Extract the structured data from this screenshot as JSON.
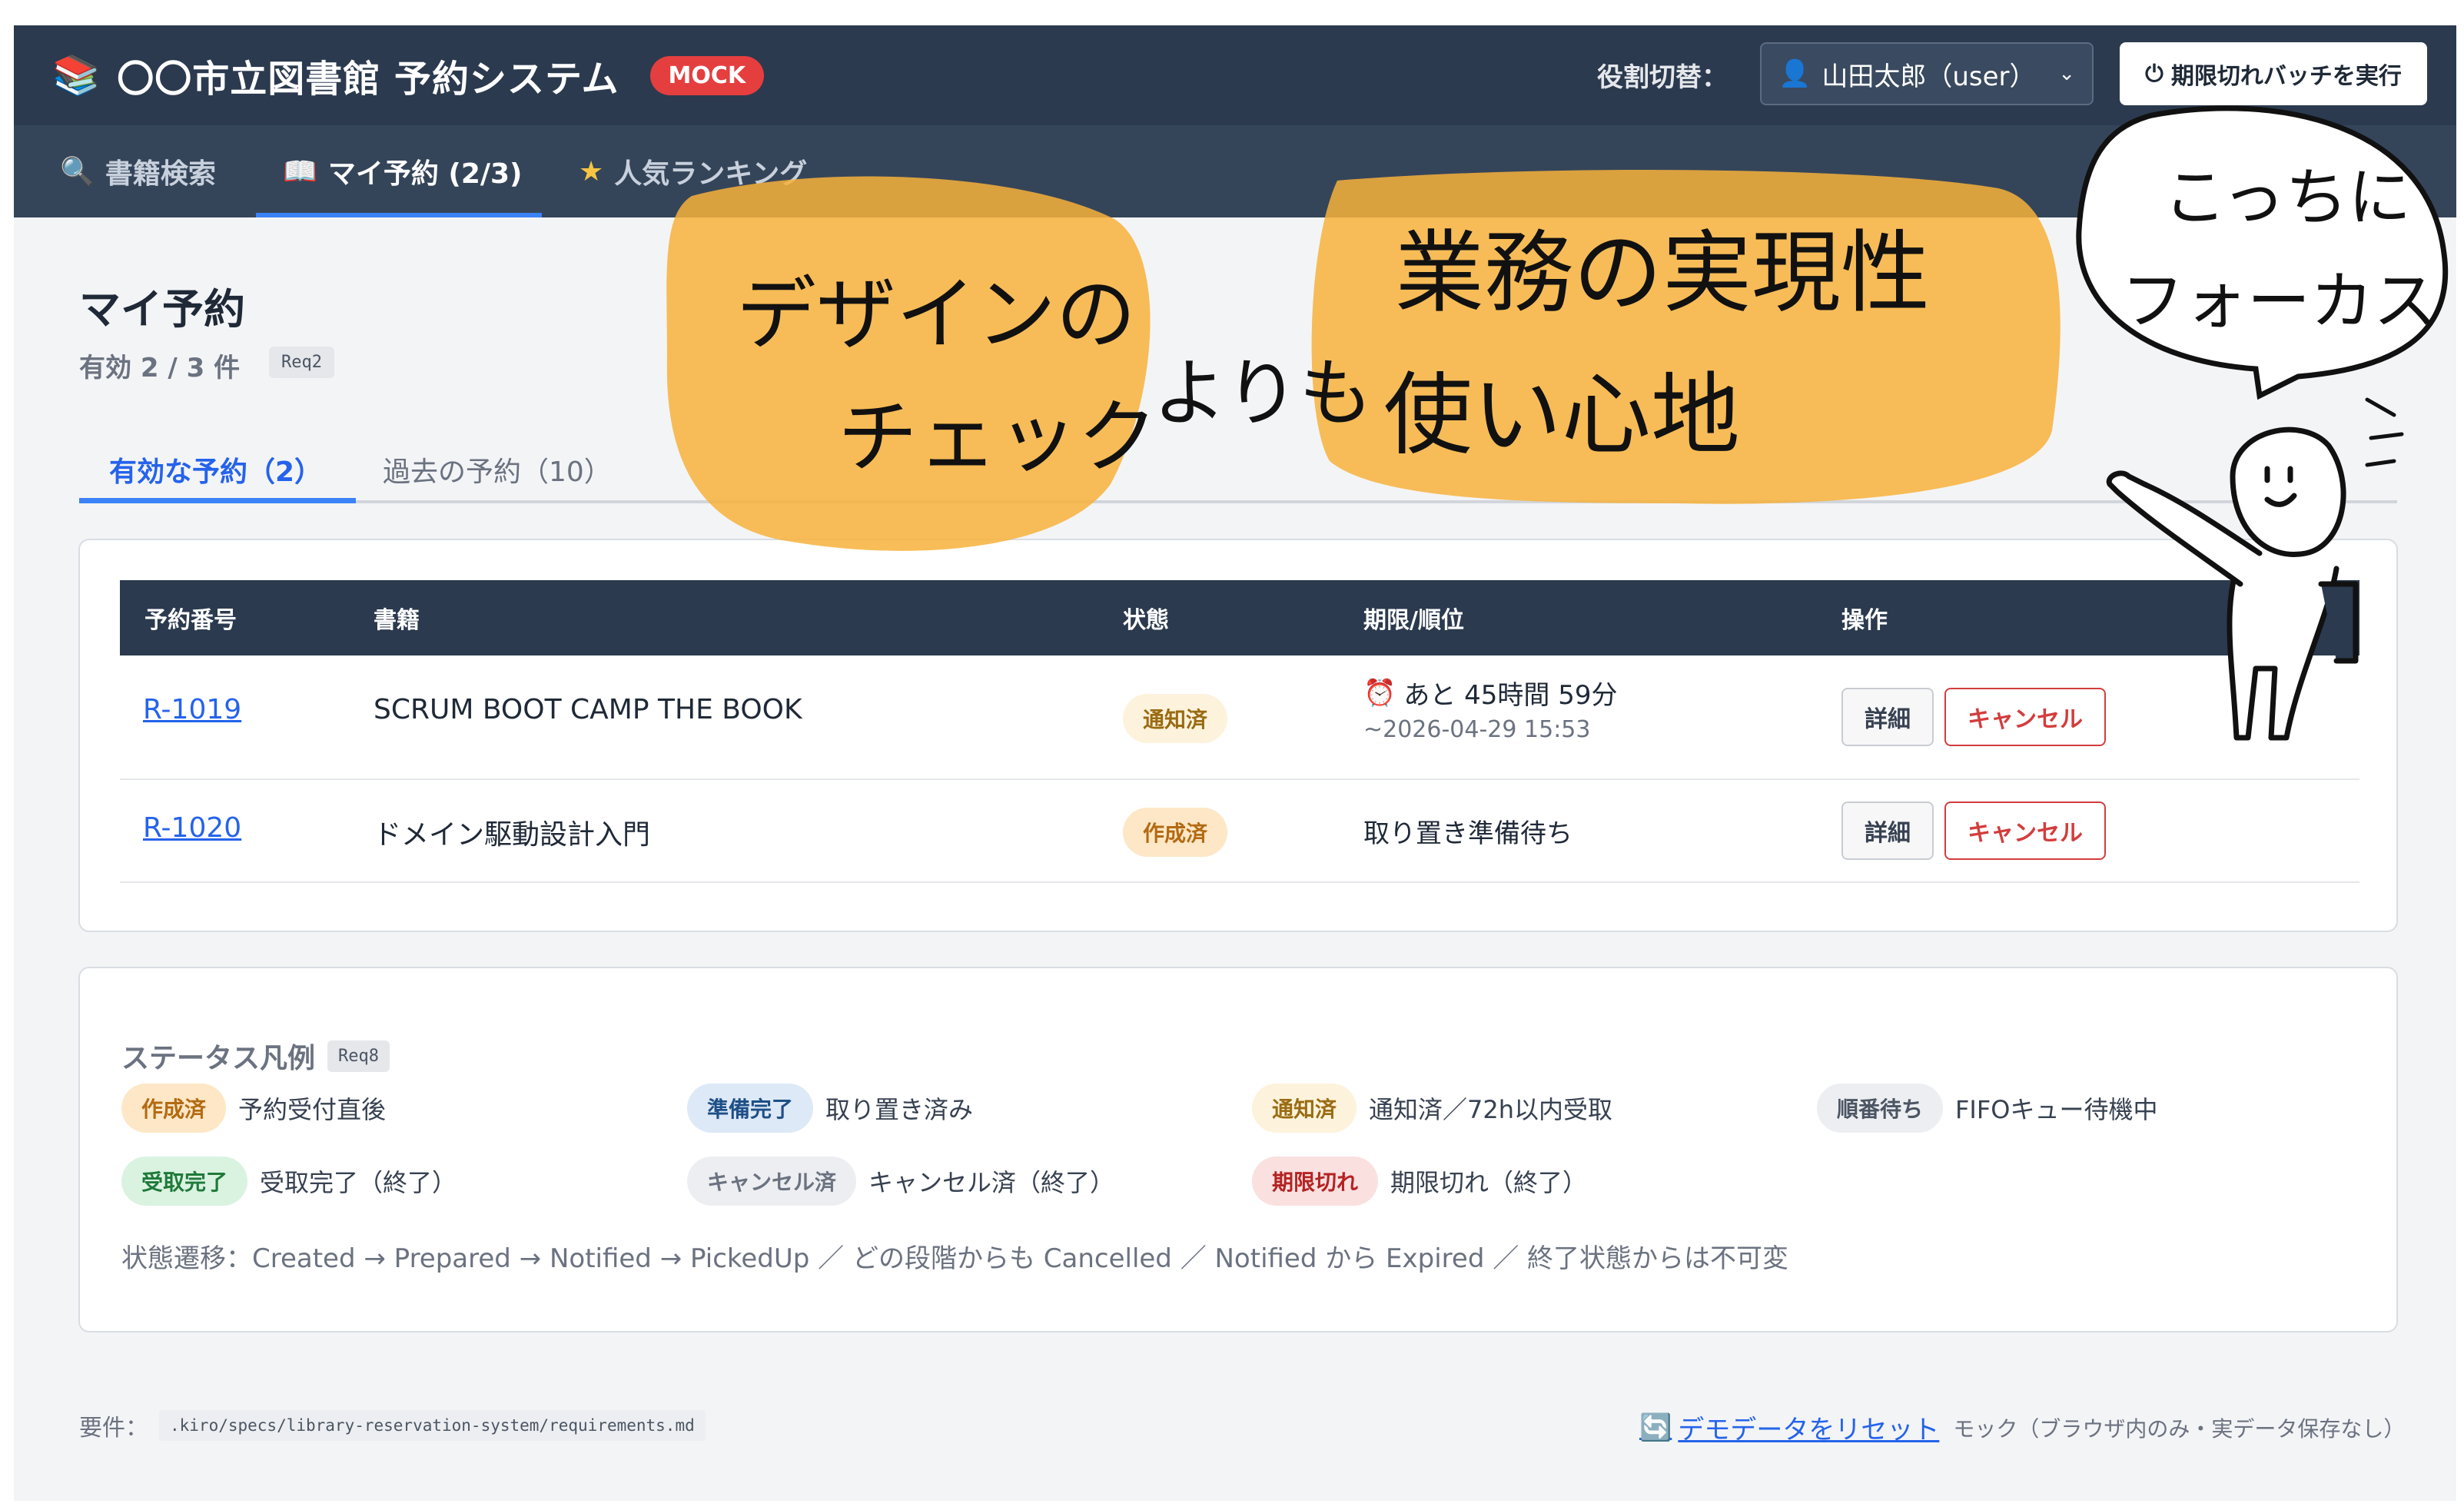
{
  "header": {
    "brand_icon": "books-icon",
    "title": "〇〇市立図書館 予約システム",
    "mock_badge": "MOCK",
    "role_label": "役割切替：",
    "role_value": "山田太郎（user）",
    "batch_button": "期限切れバッチを実行"
  },
  "nav": {
    "tabs": [
      {
        "label": "書籍検索",
        "icon": "search-icon",
        "active": false
      },
      {
        "label": "マイ予約 (2/3)",
        "icon": "book-icon",
        "active": true
      },
      {
        "label": "人気ランキング",
        "icon": "star-icon",
        "active": false
      }
    ]
  },
  "page": {
    "title": "マイ予約",
    "count": "有効 2 / 3 件",
    "req_tag": "Req2",
    "subtabs": [
      {
        "label": "有効な予約（2）",
        "active": true
      },
      {
        "label": "過去の予約（10）",
        "active": false
      }
    ]
  },
  "table": {
    "columns": [
      "予約番号",
      "書籍",
      "状態",
      "期限/順位",
      "操作"
    ],
    "rows": [
      {
        "id": "R-1019",
        "book": "SCRUM BOOT CAMP THE BOOK",
        "status": "通知済",
        "deadline_line1": "あと 45時間 59分",
        "deadline_line2": "~2026-04-29 15:53",
        "detail": "詳細",
        "cancel": "キャンセル"
      },
      {
        "id": "R-1020",
        "book": "ドメイン駆動設計入門",
        "status": "作成済",
        "deadline_line1": "取り置き準備待ち",
        "detail": "詳細",
        "cancel": "キャンセル"
      }
    ]
  },
  "legend": {
    "title": "ステータス凡例",
    "req_tag": "Req8",
    "items": [
      {
        "badge": "作成済",
        "text": "予約受付直後"
      },
      {
        "badge": "準備完了",
        "text": "取り置き済み"
      },
      {
        "badge": "通知済",
        "text": "通知済／72h以内受取"
      },
      {
        "badge": "順番待ち",
        "text": "FIFOキュー待機中"
      },
      {
        "badge": "受取完了",
        "text": "受取完了（終了）"
      },
      {
        "badge": "キャンセル済",
        "text": "キャンセル済（終了）"
      },
      {
        "badge": "期限切れ",
        "text": "期限切れ（終了）"
      }
    ],
    "transitions": "状態遷移：Created → Prepared → Notified → PickedUp ／ どの段階からも Cancelled ／ Notified から Expired ／ 終了状態からは不可変"
  },
  "footer": {
    "req_label": "要件：",
    "req_path": ".kiro/specs/library-reservation-system/requirements.md",
    "reset_link": "デモデータをリセット",
    "mock_note": "モック（ブラウザ内のみ・実データ保存なし）"
  },
  "annotation": {
    "left_bubble_line1": "デザインの",
    "left_bubble_line2": "チェック",
    "connector": "よりも",
    "right_bubble_line1": "業務の実現性",
    "right_bubble_line2": "使い心地",
    "speech_line1": "こっちに",
    "speech_line2": "フォーカス",
    "highlight_color": "#f7b23b"
  },
  "colors": {
    "header_bg": "#2b3a4e",
    "nav_bg": "#354559",
    "accent": "#2563eb",
    "danger": "#d33d3d"
  }
}
